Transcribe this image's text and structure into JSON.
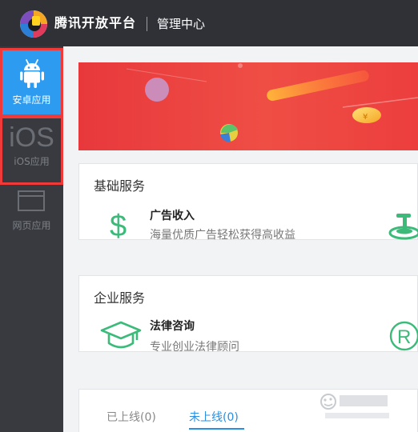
{
  "header": {
    "brand": "腾讯开放平台",
    "section": "管理中心"
  },
  "sidebar": {
    "items": [
      {
        "label": "安卓应用",
        "icon": "android-icon",
        "active": true
      },
      {
        "label": "iOS应用",
        "glyph": "iOS",
        "icon": "ios-icon",
        "active": false
      },
      {
        "label": "网页应用",
        "icon": "browser-window-icon",
        "active": false
      }
    ]
  },
  "cards": {
    "basic": {
      "title": "基础服务",
      "service": {
        "name": "广告收入",
        "desc": "海量优质广告轻松获得高收益",
        "icon": "dollar-icon"
      }
    },
    "enterprise": {
      "title": "企业服务",
      "service": {
        "name": "法律咨询",
        "desc": "专业创业法律顾问",
        "icon": "graduation-cap-icon"
      }
    }
  },
  "tabs": [
    {
      "label": "已上线(0)",
      "active": false
    },
    {
      "label": "未上线(0)",
      "active": true
    }
  ],
  "colors": {
    "topbar": "#2f3136",
    "sidebar": "#383a3f",
    "active_item": "#2d9cf0",
    "highlight_box": "#f03a3a",
    "banner": "#e8383c",
    "icon_green": "#3cba7a",
    "tab_active": "#2a8fe0"
  }
}
